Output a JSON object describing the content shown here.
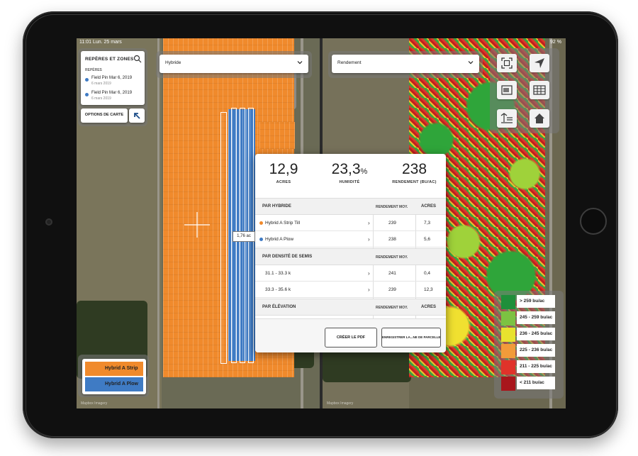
{
  "status_bar": {
    "time": "11:01  Lun. 25 mars",
    "battery": "92 %"
  },
  "left_panel": {
    "pins_card": {
      "title": "REPÈRES ET ZONES",
      "section": "REPÈRES",
      "pins": [
        {
          "name": "Field Pin Mar 6, 2019",
          "date": "6 mars 2019"
        },
        {
          "name": "Field Pin Mar 6, 2019",
          "date": "6 mars 2019"
        }
      ],
      "options_label": "OPTIONS DE CARTE"
    },
    "layer_select": {
      "value": "Hybride"
    },
    "legend": [
      {
        "label": "Hybrid A Strip Till",
        "color": "#f08a2c"
      },
      {
        "label": "Hybrid A Plow",
        "color": "#3f7bc4"
      }
    ],
    "measure_callout": "1,76 ac",
    "watermark": "Mapbox Imagery"
  },
  "right_panel": {
    "layer_select": {
      "value": "Rendement"
    },
    "toolbar_icons": [
      "fullscreen-icon",
      "locate-icon",
      "image-icon",
      "table-icon",
      "layers-list-icon",
      "home-icon"
    ],
    "legend": [
      {
        "label": "> 259 bu/ac",
        "color": "#1f8f3a"
      },
      {
        "label": "245 - 259 bu/ac",
        "color": "#7cc242"
      },
      {
        "label": "236 - 245 bu/ac",
        "color": "#e8e22e"
      },
      {
        "label": "225 - 236 bu/ac",
        "color": "#f29b3a"
      },
      {
        "label": "211 - 225 bu/ac",
        "color": "#e0332a"
      },
      {
        "label": "< 211 bu/ac",
        "color": "#a8161c"
      }
    ],
    "watermark": "Mapbox Imagery"
  },
  "summary_popup": {
    "stats": [
      {
        "value": "12,9",
        "unit_suffix": "",
        "label": "ACRES"
      },
      {
        "value": "23,3",
        "unit_suffix": "%",
        "label": "HUMIDITÉ"
      },
      {
        "value": "238",
        "unit_suffix": "",
        "label": "RENDEMENT (BU/AC)"
      }
    ],
    "sections": [
      {
        "title": "PAR HYBRIDE",
        "col_a": "RENDEMENT MOY.",
        "col_b": "ACRES",
        "rows": [
          {
            "name": "Hybrid A Strip Till",
            "color": "#f08a2c",
            "yield": "239",
            "acres": "7,3"
          },
          {
            "name": "Hybrid A Plow",
            "color": "#3f7bc4",
            "yield": "238",
            "acres": "5,6"
          }
        ]
      },
      {
        "title": "PAR DENSITÉ DE SEMIS",
        "col_a": "RENDEMENT MOY.",
        "col_b": "ACRES",
        "rows": [
          {
            "name": "31.1 - 33.3 k",
            "yield": "241",
            "acres": "0,4"
          },
          {
            "name": "33.3 - 35.6 k",
            "yield": "239",
            "acres": "12,3"
          }
        ]
      },
      {
        "title": "PAR ÉLÉVATION",
        "col_a": "RENDEMENT MOY.",
        "col_b": "ACRES",
        "rows": []
      }
    ],
    "buttons": {
      "pdf": "CRÉER LE PDF",
      "save": "ENREGISTRER LA...NE DE PARCELLE"
    }
  }
}
